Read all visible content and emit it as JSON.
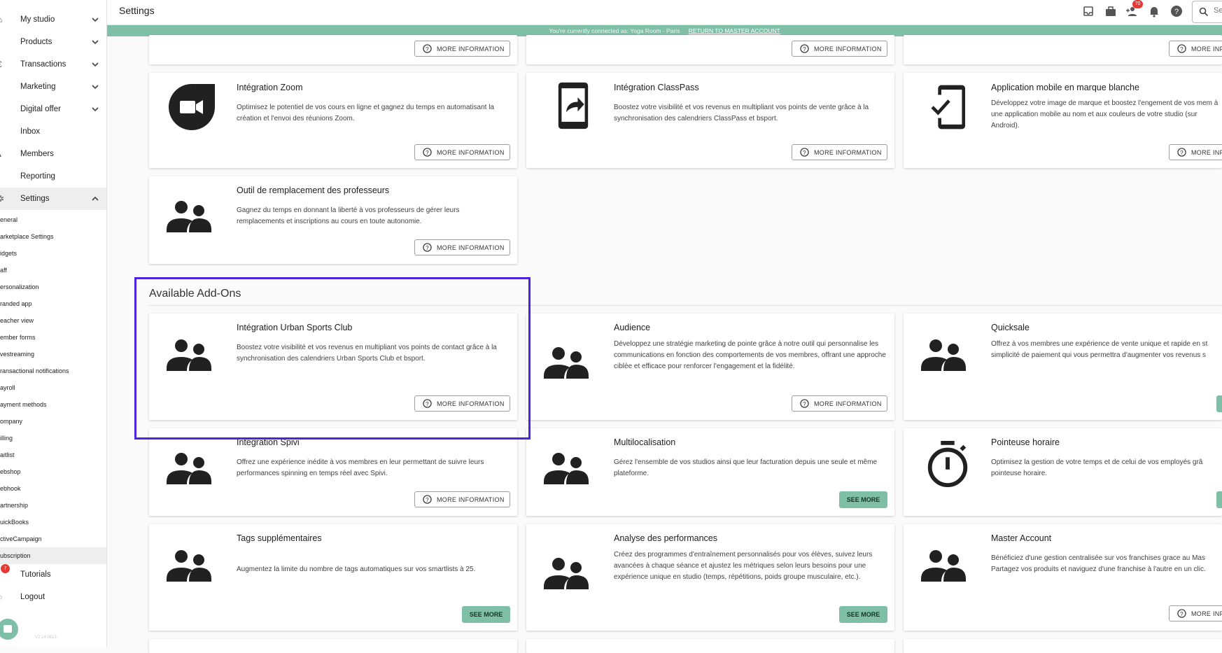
{
  "sidebar": {
    "items": [
      {
        "label": "My studio",
        "icon": "home-icon"
      },
      {
        "label": "Products",
        "icon": "tag-icon"
      },
      {
        "label": "Transactions",
        "icon": "currency-icon"
      },
      {
        "label": "Marketing",
        "icon": "chart-icon"
      },
      {
        "label": "Digital offer",
        "icon": "laptop-icon"
      },
      {
        "label": "Inbox",
        "icon": "inbox-icon"
      },
      {
        "label": "Members",
        "icon": "people-icon"
      },
      {
        "label": "Reporting",
        "icon": "report-icon"
      },
      {
        "label": "Settings",
        "icon": "gear-icon"
      }
    ],
    "settings_sub": [
      "eneral",
      "arketplace Settings",
      "idgets",
      "aff",
      "ersonalization",
      "randed app",
      "eacher view",
      "ember forms",
      "vestreaming",
      "ransactional notifications",
      "ayroll",
      "ayment methods",
      "ompany",
      "illing",
      "aitlist",
      "ebshop",
      "ebhook",
      "artnership",
      "uickBooks",
      "ctiveCampaign",
      "ubscription"
    ],
    "bottom": [
      {
        "label": "Tutorials",
        "badge": "7"
      },
      {
        "label": "Logout"
      }
    ],
    "version": "V2.14.0613"
  },
  "header": {
    "title": "Settings",
    "notification_count": "70",
    "search_placeholder": "Se"
  },
  "banner": {
    "text": "You're currently connected as: Yoga Room - Paris",
    "link": "RETURN TO MASTER ACCOUNT"
  },
  "labels": {
    "more_info": "MORE INFORMATION",
    "more_info_cut": "MORE INF",
    "see_more": "SEE MORE"
  },
  "integrations": [
    {
      "title": "Intégration Zoom",
      "desc": "Optimisez le potentiel de vos cours en ligne et gagnez du temps en automatisant la création et l'envoi des réunions Zoom."
    },
    {
      "title": "Intégration ClassPass",
      "desc": "Boostez votre visibilité et vos revenus en multipliant vos points de vente grâce à la synchronisation des calendriers ClassPass et bsport."
    },
    {
      "title": "Application mobile en marque blanche",
      "desc": "Développez votre image de marque et boostez l'engement de vos mem à une application mobile au nom et aux couleurs de votre studio (sur Android)."
    },
    {
      "title": "Outil de remplacement des professeurs",
      "desc": "Gagnez du temps en donnant la liberté à vos professeurs de gérer leurs remplacements et inscriptions au cours en toute autonomie."
    }
  ],
  "addons_title": "Available Add-Ons",
  "addons": [
    {
      "title": "Intégration Urban Sports Club",
      "desc": "Boostez votre visibilité et vos revenus en multipliant vos points de contact grâce à la synchronisation des calendriers Urban Sports Club et bsport."
    },
    {
      "title": "Audience",
      "desc": "Développez une stratégie marketing de pointe grâce à notre outil qui personnalise les communications en fonction des comportements de vos membres, offrant une approche ciblée et efficace pour renforcer l'engagement et la fidélité."
    },
    {
      "title": "Quicksale",
      "desc": "Offrez à vos membres une expérience de vente unique et rapide en st simplicité de paiement qui vous permettra d'augmenter vos revenus s"
    },
    {
      "title": "Intégration Spivi",
      "desc": "Offrez une expérience inédite à vos membres en leur permettant de suivre leurs performances spinning en temps réel avec Spivi."
    },
    {
      "title": "Multilocalisation",
      "desc": "Gérez l'ensemble de vos studios ainsi que leur facturation depuis une seule et même plateforme."
    },
    {
      "title": "Pointeuse horaire",
      "desc": "Optimisez la gestion de votre temps et de celui de vos employés grâ pointeuse horaire."
    },
    {
      "title": "Tags supplémentaires",
      "desc": "Augmentez la limite du nombre de tags automatiques sur vos smartlists à 25."
    },
    {
      "title": "Analyse des performances",
      "desc": "Créez des programmes d'entraînement personnalisés pour vos élèves, suivez leurs avancées à chaque séance et ajustez les métriques selon leurs besoins pour une expérience unique en studio (temps, répétitions, poids groupe musculaire, etc.)."
    },
    {
      "title": "Master Account",
      "desc": "Bénéficiez d'une gestion centralisée sur vos franchises grace au Mas Partagez vos produits et naviguez d'une franchise à l'autre en un clic."
    }
  ]
}
